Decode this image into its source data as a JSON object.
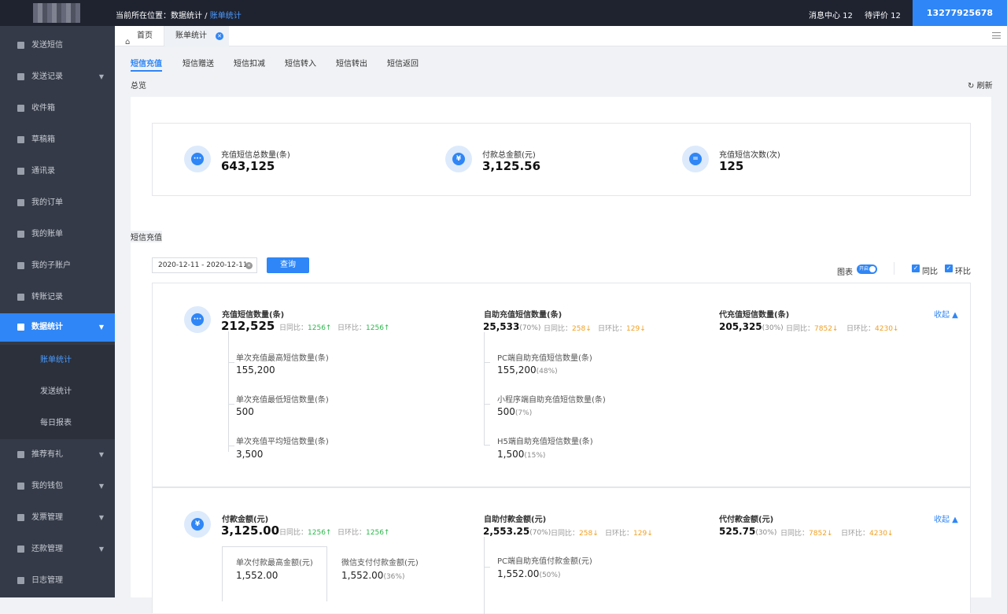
{
  "header": {
    "breadcrumb_prefix": "当前所在位置：",
    "breadcrumb_parent": "数据统计",
    "breadcrumb_sep": " / ",
    "breadcrumb_current": "账单统计",
    "msg_center": "消息中心 12",
    "pending_review": "待评价 12",
    "phone": "13277925678"
  },
  "sidebar": {
    "items": [
      {
        "label": "发送短信"
      },
      {
        "label": "发送记录"
      },
      {
        "label": "收件箱"
      },
      {
        "label": "草稿箱"
      },
      {
        "label": "通讯录"
      },
      {
        "label": "我的订单"
      },
      {
        "label": "我的账单"
      },
      {
        "label": "我的子账户"
      },
      {
        "label": "转账记录"
      },
      {
        "label": "数据统计"
      },
      {
        "label": "推荐有礼"
      },
      {
        "label": "我的钱包"
      },
      {
        "label": "发票管理"
      },
      {
        "label": "还款管理"
      },
      {
        "label": "日志管理"
      }
    ],
    "subitems": [
      {
        "label": "账单统计"
      },
      {
        "label": "发送统计"
      },
      {
        "label": "每日报表"
      }
    ]
  },
  "tabs": {
    "home": "首页",
    "bill": "账单统计"
  },
  "subtabs": [
    "短信充值",
    "短信赠送",
    "短信扣减",
    "短信转入",
    "短信转出",
    "短信返回"
  ],
  "overview": {
    "title": "总览",
    "refresh": "刷新",
    "items": [
      {
        "label": "充值短信总数量(条)",
        "value": "643,125",
        "icon": "chat-icon"
      },
      {
        "label": "付款总金额(元)",
        "value": "3,125.56",
        "icon": "yuan-icon"
      },
      {
        "label": "充值短信次数(次)",
        "value": "125",
        "icon": "equals-icon"
      }
    ]
  },
  "recharge": {
    "title": "短信充值",
    "date_range": "2020-12-11  -  2020-12-11",
    "query_button": "查询",
    "chart_label": "图表",
    "toggle_label": "开启",
    "yoy": "同比",
    "mom": "环比",
    "collapse": "收起 ▲"
  },
  "card1": {
    "main_label": "充值短信数量(条)",
    "main_value": "212,525",
    "main_day_yoy": "日同比：",
    "main_day_yoy_val": "1256↑",
    "main_day_mom": "日环比：",
    "main_day_mom_val": "1256↑",
    "sub": [
      {
        "label": "单次充值最高短信数量(条)",
        "value": "155,200"
      },
      {
        "label": "单次充值最低短信数量(条)",
        "value": "500"
      },
      {
        "label": "单次充值平均短信数量(条)",
        "value": "3,500"
      }
    ],
    "self_label": "自助充值短信数量(条)",
    "self_value": "25,533",
    "self_pct": "(70%)",
    "self_day_yoy_val": "258↓",
    "self_day_mom_val": "129↓",
    "self_sub": [
      {
        "label": "PC端自助充值短信数量(条)",
        "value": "155,200",
        "pct": "(48%)"
      },
      {
        "label": "小程序端自助充值短信数量(条)",
        "value": "500",
        "pct": "(7%)"
      },
      {
        "label": "H5端自助充值短信数量(条)",
        "value": "1,500",
        "pct": "(15%)"
      }
    ],
    "agent_label": "代充值短信数量(条)",
    "agent_value": "205,325",
    "agent_pct": "(30%)",
    "agent_day_yoy_val": "7852↓",
    "agent_day_mom_val": "4230↓"
  },
  "card2": {
    "main_label": "付款金额(元)",
    "main_value": "3,125.00",
    "main_day_yoy_val": "1256↑",
    "main_day_mom_val": "1256↑",
    "sub_left": {
      "label": "单次付款最高金额(元)",
      "value": "1,552.00"
    },
    "sub_right": {
      "label": "微信支付付款金额(元)",
      "value": "1,552.00",
      "pct": "(36%)"
    },
    "self_label": "自助付款金额(元)",
    "self_value": "2,553.25",
    "self_pct": "(70%)",
    "self_day_yoy_val": "258↓",
    "self_day_mom_val": "129↓",
    "self_sub": {
      "label": "PC端自助充值付款金额(元)",
      "value": "1,552.00",
      "pct": "(50%)"
    },
    "agent_label": "代付款金额(元)",
    "agent_value": "525.75",
    "agent_pct": "(30%)",
    "agent_day_yoy_val": "7852↓",
    "agent_day_mom_val": "4230↓"
  }
}
